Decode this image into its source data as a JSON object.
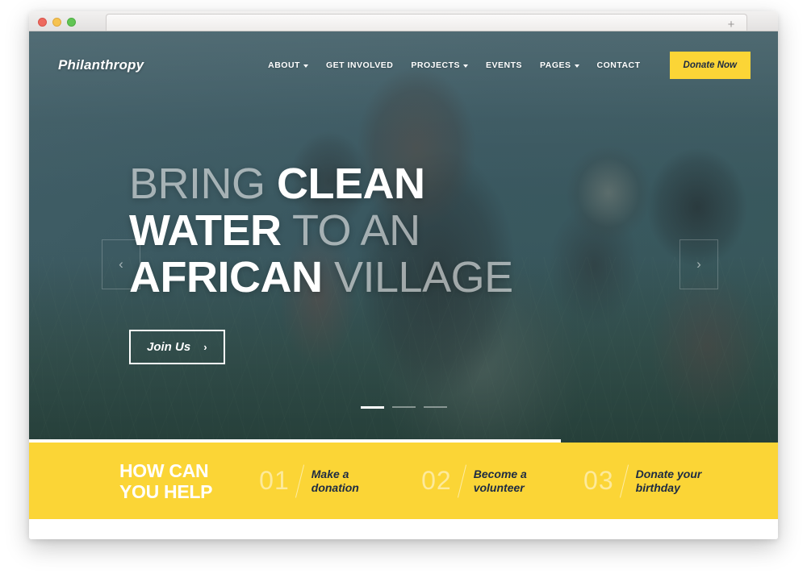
{
  "browser": {
    "traffic_lights": [
      "close",
      "minimize",
      "zoom"
    ],
    "new_tab_label": "+"
  },
  "header": {
    "brand": "Philanthropy",
    "nav": [
      {
        "label": "ABOUT",
        "has_dropdown": true
      },
      {
        "label": "GET INVOLVED",
        "has_dropdown": false
      },
      {
        "label": "PROJECTS",
        "has_dropdown": true
      },
      {
        "label": "EVENTS",
        "has_dropdown": false
      },
      {
        "label": "PAGES",
        "has_dropdown": true
      },
      {
        "label": "CONTACT",
        "has_dropdown": false
      }
    ],
    "donate_label": "Donate Now"
  },
  "hero": {
    "headline": {
      "line1_light": "BRING ",
      "line1_bold": "CLEAN",
      "line2_bold": "WATER",
      "line2_light": " TO AN",
      "line3_bold": "AFRICAN",
      "line3_light": " VILLAGE"
    },
    "cta_label": "Join Us",
    "cta_arrow": "›",
    "prev_arrow": "‹",
    "next_arrow": "›",
    "slides": [
      {
        "active": true
      },
      {
        "active": false
      },
      {
        "active": false
      }
    ],
    "scroll_progress_percent": 71
  },
  "help_band": {
    "title_line1": "HOW CAN",
    "title_line2": "YOU HELP",
    "items": [
      {
        "number": "01",
        "label": "Make a\ndonation"
      },
      {
        "number": "02",
        "label": "Become a\nvolunteer"
      },
      {
        "number": "03",
        "label": "Donate your\nbirthday"
      }
    ]
  },
  "colors": {
    "accent_yellow": "#FBD536",
    "hero_teal": "#3D5A63",
    "dark_navy": "#1D2B43",
    "white": "#FFFFFF"
  }
}
